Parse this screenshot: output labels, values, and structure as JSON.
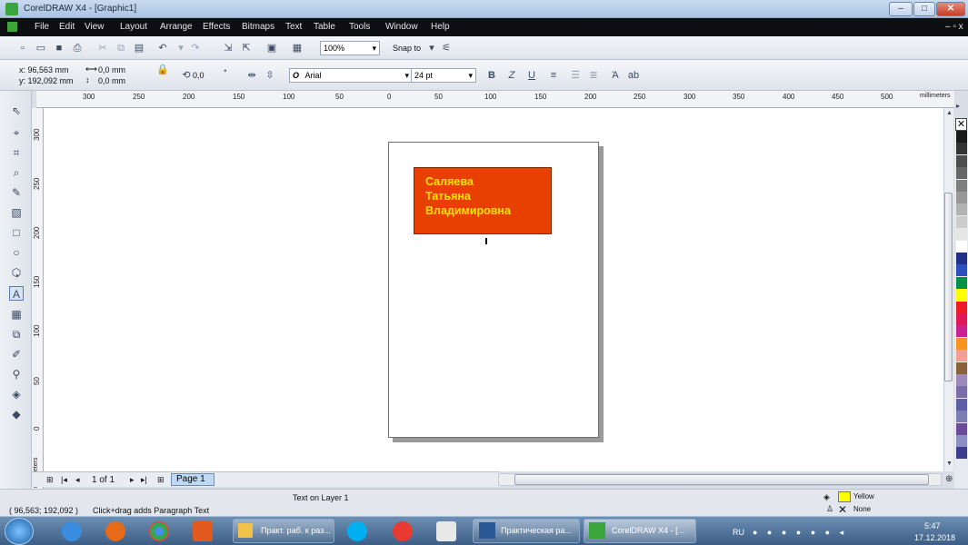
{
  "window": {
    "title": "CorelDRAW X4 - [Graphic1]",
    "minimize": "–",
    "maximize": "□",
    "close": "✕"
  },
  "menu": [
    "File",
    "Edit",
    "View",
    "Layout",
    "Arrange",
    "Effects",
    "Bitmaps",
    "Text",
    "Table",
    "Tools",
    "Window",
    "Help"
  ],
  "toolbar": {
    "zoom": "100%",
    "snap_to": "Snap to"
  },
  "property_bar": {
    "x": "x: 96,563 mm",
    "y": "y: 192,092 mm",
    "w": "0,0 mm",
    "h": "0,0 mm",
    "angle": "0,0",
    "degree": "°",
    "font": "Arial",
    "font_size": "24 pt"
  },
  "ruler": {
    "h_labels": [
      "300",
      "250",
      "200",
      "150",
      "100",
      "50",
      "0",
      "50",
      "100",
      "150",
      "200",
      "250",
      "300",
      "350",
      "400",
      "450",
      "500"
    ],
    "unit": "millimeters",
    "v_labels": [
      "300",
      "250",
      "200",
      "150",
      "100",
      "50",
      "0"
    ],
    "v_unit": "millimeters"
  },
  "document": {
    "text_lines": [
      "Саляева",
      "Татьяна",
      "Владимировна"
    ],
    "fill_color": "#e84000",
    "text_color": "#ffe400"
  },
  "page_nav": {
    "counter": "1 of 1",
    "tab": "Page 1"
  },
  "status": {
    "layer_info": "Text on Layer 1",
    "coords": "( 96,563; 192,092 )",
    "hint": "Click+drag adds Paragraph Text",
    "fill_label": "Yellow",
    "outline_label": "None"
  },
  "palette": [
    "#ffffff",
    "#1a1a1a",
    "#333333",
    "#4d4d4d",
    "#666666",
    "#7f7f7f",
    "#999999",
    "#b3b3b3",
    "#cccccc",
    "#e6e6e6",
    "#ffffff",
    "#1f2f8a",
    "#2b4fbf",
    "#00904a",
    "#ffff00",
    "#ee1c24",
    "#e0185a",
    "#c9218f",
    "#f7941d",
    "#f2a096",
    "#8c6239",
    "#9e8ab9",
    "#7b6ba8",
    "#5d5fa6",
    "#7a7fb3",
    "#6c4c9a",
    "#8b8fc4",
    "#3d3d8f"
  ],
  "taskbar": {
    "items": [
      "Практ. раб. к раз...",
      "Практическая ра...",
      "CorelDRAW X4 - [..."
    ],
    "lang": "RU",
    "time": "5:47",
    "date": "17.12.2018"
  }
}
